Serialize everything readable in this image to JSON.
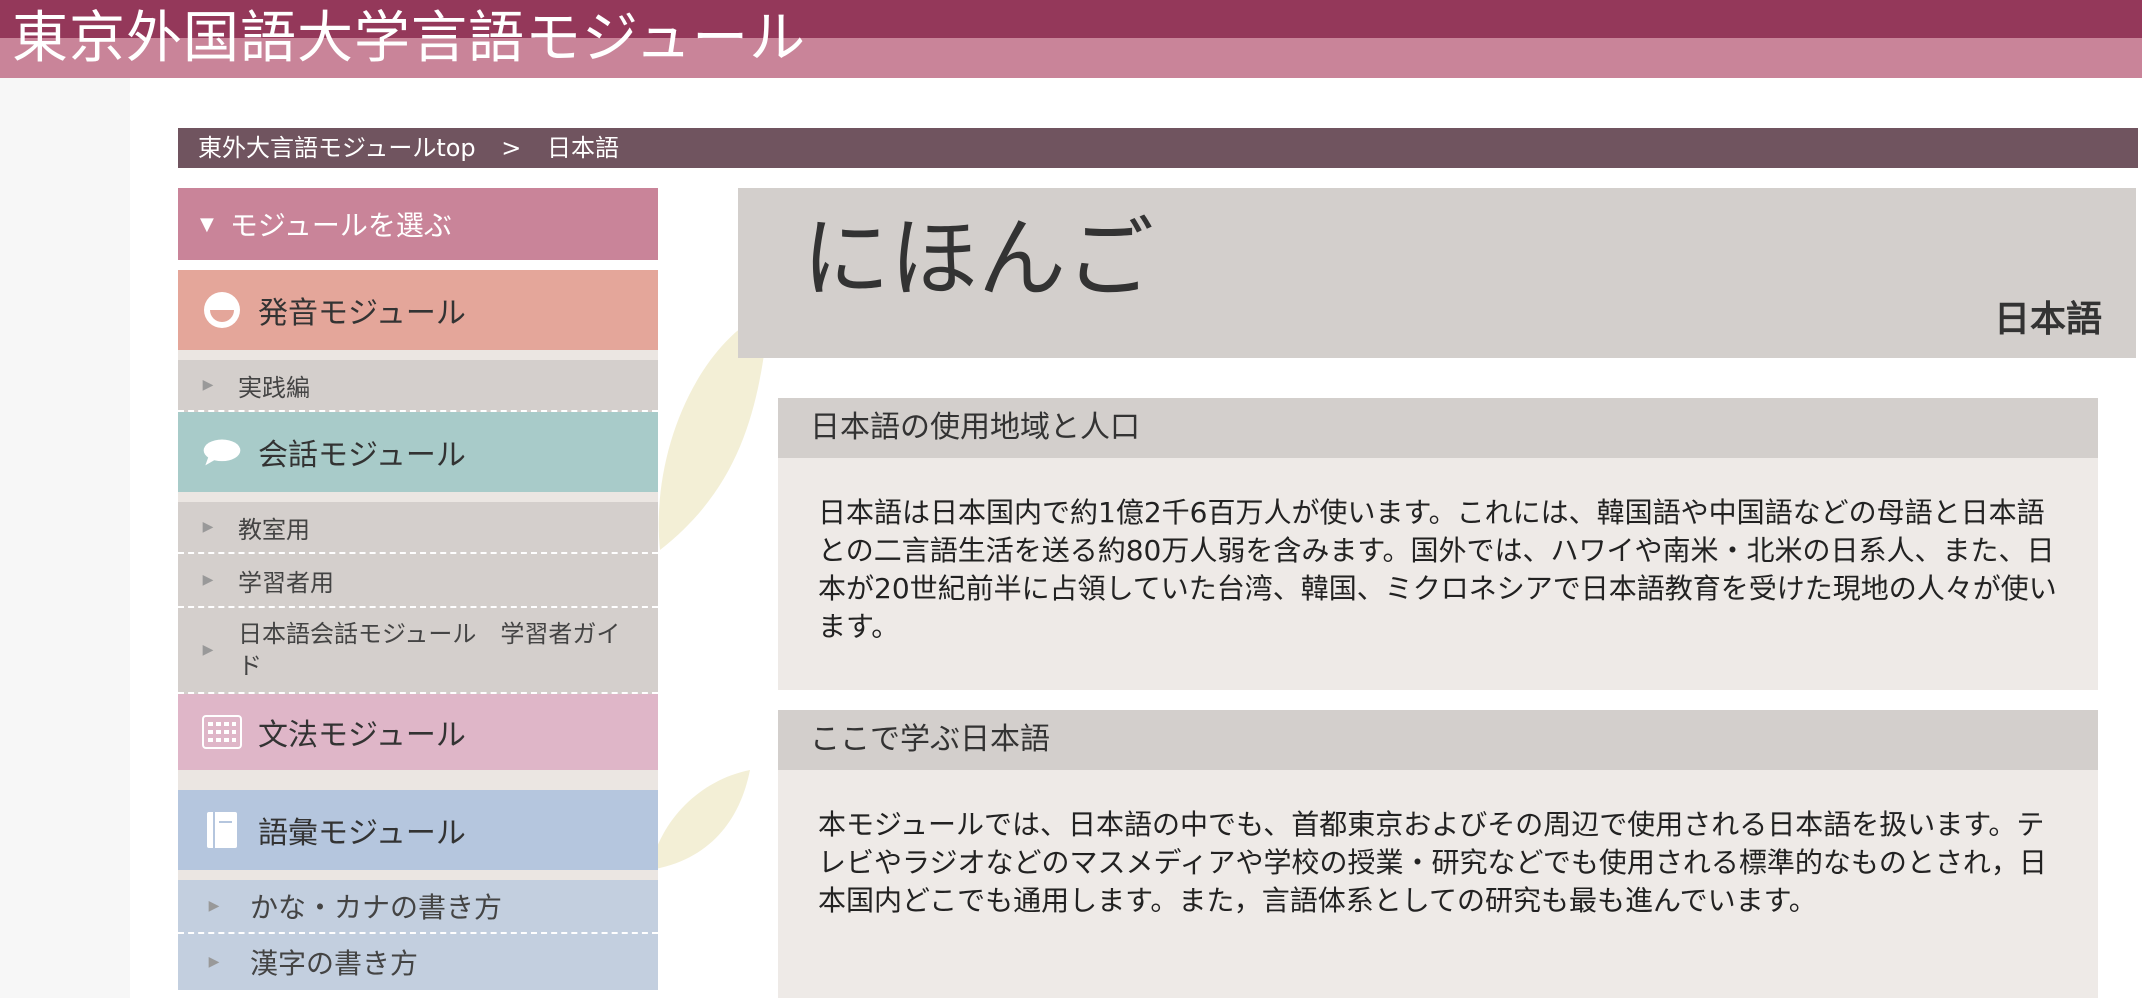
{
  "header": {
    "site_title": "東京外国語大学言語モジュール"
  },
  "breadcrumb": {
    "home": "東外大言語モジュールtop",
    "separator": ">",
    "current": "日本語"
  },
  "sidebar": {
    "head": "モジュールを選ぶ",
    "modules": {
      "pronunciation": {
        "label": "発音モジュール",
        "icon": "smile-face-icon",
        "color": "#e4a69a",
        "subitems": [
          "実践編"
        ]
      },
      "conversation": {
        "label": "会話モジュール",
        "icon": "speech-bubble-icon",
        "color": "#a8cbc9",
        "subitems": [
          "教室用",
          "学習者用",
          "日本語会話モジュール　学習者ガイド"
        ]
      },
      "grammar": {
        "label": "文法モジュール",
        "icon": "keyboard-icon",
        "color": "#dfb6c8",
        "subitems": []
      },
      "vocabulary": {
        "label": "語彙モジュール",
        "icon": "book-icon",
        "color": "#b5c6de",
        "subitems": [
          "かな・カナの書き方",
          "漢字の書き方"
        ]
      }
    }
  },
  "main": {
    "title_kana": "にほんご",
    "title_kanji": "日本語",
    "sections": [
      {
        "heading": "日本語の使用地域と人口",
        "body": "日本語は日本国内で約1億2千6百万人が使います。これには、韓国語や中国語などの母語と日本語との二言語生活を送る約80万人弱を含みます。国外では、ハワイや南米・北米の日系人、また、日本が20世紀前半に占領していた台湾、韓国、ミクロネシアで日本語教育を受けた現地の人々が使います。"
      },
      {
        "heading": "ここで学ぶ日本語",
        "body": "本モジュールでは、日本語の中でも、首都東京およびその周辺で使用される日本語を扱います。テレビやラジオなどのマスメディアや学校の授業・研究などでも使用される標準的なものとされ，日本国内どこでも通用します。また，言語体系としての研究も最も進んでいます。"
      }
    ]
  },
  "colors": {
    "header": "#94385a",
    "header_light": "#c98499",
    "breadcrumb": "#70545f"
  }
}
